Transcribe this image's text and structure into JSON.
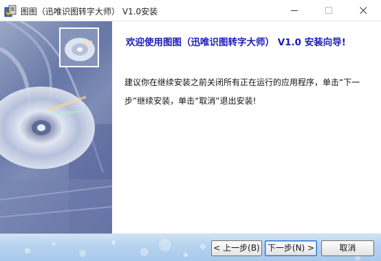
{
  "window": {
    "title": "图图（迅唯识图转字大师） V1.0安装",
    "icons": [
      "installer-icon",
      "minimize-icon",
      "maximize-icon",
      "close-icon"
    ]
  },
  "wizard": {
    "heading": "欢迎使用图图（迅唯识图转字大师） V1.0 安装向导!",
    "body": "建议你在继续安装之前关闭所有正在运行的应用程序，单击“下一步”继续安装，单击“取消”退出安装!"
  },
  "buttons": {
    "back": "< 上一步(B)",
    "next": "下一步(N) >",
    "cancel": "取消"
  },
  "colors": {
    "heading": "#1a1ab8",
    "banner": "#6677a6",
    "bottom_bar": "#b7d3ef"
  }
}
